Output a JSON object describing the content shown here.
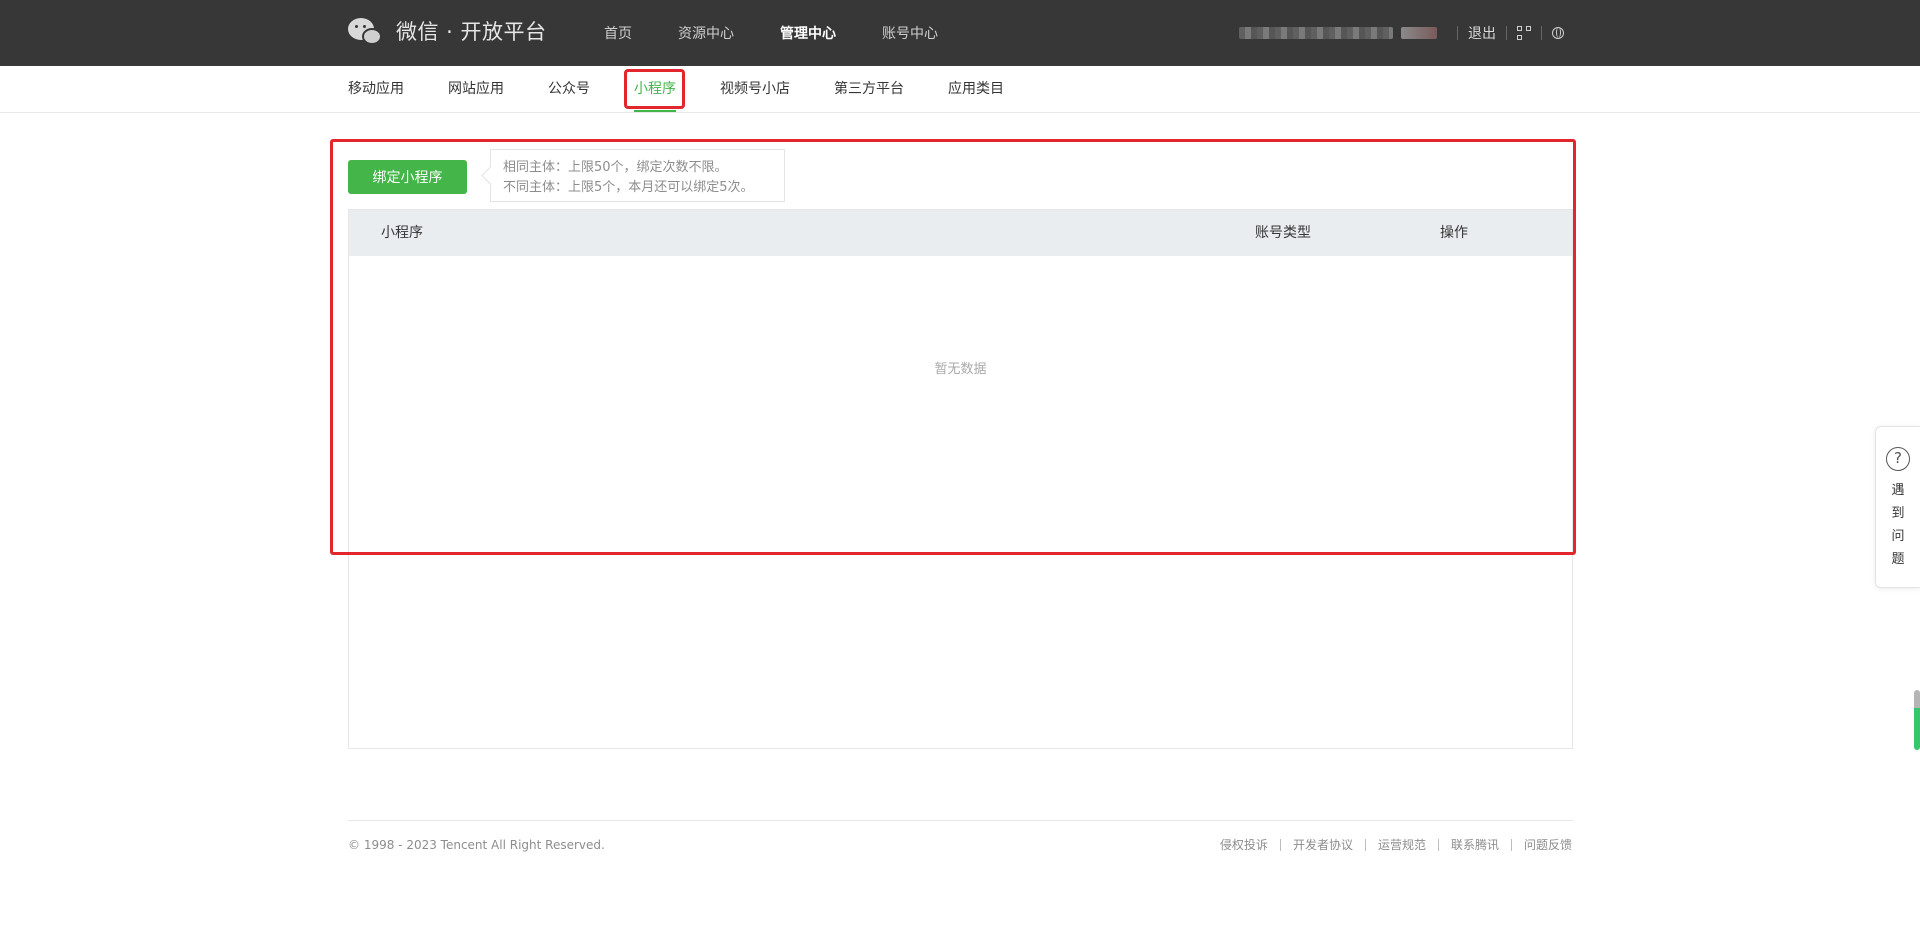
{
  "brand": {
    "title": "微信 · 开放平台"
  },
  "top_nav": [
    {
      "label": "首页",
      "active": false
    },
    {
      "label": "资源中心",
      "active": false
    },
    {
      "label": "管理中心",
      "active": true
    },
    {
      "label": "账号中心",
      "active": false
    }
  ],
  "top_right": {
    "logout_label": "退出"
  },
  "sub_nav": [
    {
      "label": "移动应用",
      "active": false
    },
    {
      "label": "网站应用",
      "active": false
    },
    {
      "label": "公众号",
      "active": false
    },
    {
      "label": "小程序",
      "active": true
    },
    {
      "label": "视频号小店",
      "active": false
    },
    {
      "label": "第三方平台",
      "active": false
    },
    {
      "label": "应用类目",
      "active": false
    }
  ],
  "main": {
    "bind_button_label": "绑定小程序",
    "tip_line_1": "相同主体：上限50个，绑定次数不限。",
    "tip_line_2": "不同主体：上限5个，本月还可以绑定5次。",
    "table": {
      "columns": [
        "小程序",
        "账号类型",
        "操作"
      ],
      "empty_text": "暂无数据"
    }
  },
  "footer": {
    "copyright": "© 1998 - 2023 Tencent All Right Reserved.",
    "links": [
      "侵权投诉",
      "开发者协议",
      "运营规范",
      "联系腾讯",
      "问题反馈"
    ]
  },
  "help_float": {
    "icon_text": "?",
    "label": "遇到问题"
  },
  "colors": {
    "accent": "#44b549",
    "header_bg": "#373737",
    "highlight": "#e3262b"
  }
}
